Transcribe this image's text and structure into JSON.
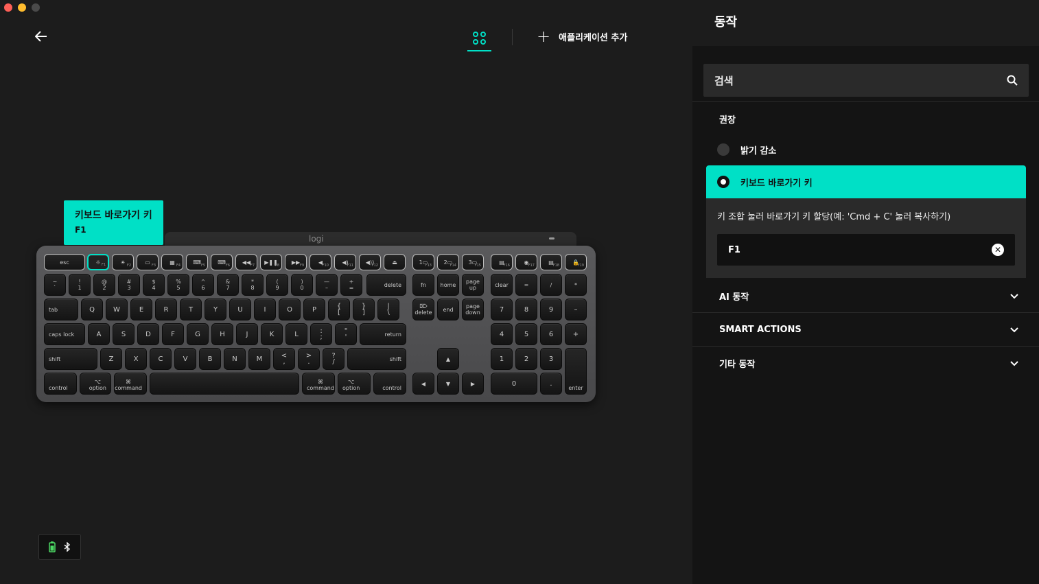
{
  "window": {
    "traffic_lights": [
      "close",
      "minimize",
      "maximize"
    ]
  },
  "topbar": {
    "back_icon": "arrow-left-icon",
    "apps_icon": "apps-grid-icon",
    "add_app_label": "애플리케이션 추가",
    "accent_color": "#00e0c6"
  },
  "keyboard": {
    "logo": "logi",
    "selected_key": "F1",
    "tooltip": {
      "title": "키보드 바로가기 키",
      "key": "F1"
    },
    "rows": {
      "fn": [
        {
          "main": "esc",
          "sub": "",
          "w": 1
        },
        {
          "main": "☼",
          "sub": "F1",
          "sel": true
        },
        {
          "main": "☀",
          "sub": "F2"
        },
        {
          "main": "▭",
          "sub": "F3"
        },
        {
          "main": "▦",
          "sub": "F4"
        },
        {
          "main": "⌨",
          "sub": "F5"
        },
        {
          "main": "⌨",
          "sub": "F6"
        },
        {
          "main": "◀◀",
          "sub": "F7"
        },
        {
          "main": "▶❚❚",
          "sub": "F8"
        },
        {
          "main": "▶▶",
          "sub": "F9"
        },
        {
          "main": "◀",
          "sub": "F10"
        },
        {
          "main": "◀)",
          "sub": "F11"
        },
        {
          "main": "◀))",
          "sub": "F12"
        },
        {
          "main": "⏏",
          "sub": ""
        },
        {
          "main": "1▭",
          "sub": "F13"
        },
        {
          "main": "2▭",
          "sub": "F14"
        },
        {
          "main": "3▭",
          "sub": "F15"
        },
        {
          "main": "▤",
          "sub": "F16"
        },
        {
          "main": "◉",
          "sub": "F17"
        },
        {
          "main": "▤",
          "sub": "F18"
        },
        {
          "main": "🔒",
          "sub": "F19"
        }
      ],
      "num": [
        [
          "~",
          "`"
        ],
        [
          "!",
          "1"
        ],
        [
          "@",
          "2"
        ],
        [
          "#",
          "3"
        ],
        [
          "$",
          "4"
        ],
        [
          "%",
          "5"
        ],
        [
          "^",
          "6"
        ],
        [
          "&",
          "7"
        ],
        [
          "*",
          "8"
        ],
        [
          "(",
          "9"
        ],
        [
          ")",
          "0"
        ],
        [
          "—",
          "–"
        ],
        [
          "+",
          "="
        ],
        [
          "",
          "delete"
        ],
        [
          "",
          "fn"
        ],
        [
          "",
          "home"
        ],
        [
          "page",
          "up"
        ],
        [
          "",
          "clear"
        ],
        [
          "",
          "="
        ],
        [
          "",
          "/"
        ],
        [
          "",
          "*"
        ]
      ],
      "qwerty": [
        "tab",
        "Q",
        "W",
        "E",
        "R",
        "T",
        "Y",
        "U",
        "I",
        "O",
        "P",
        "{ [",
        "} ]",
        "| \\",
        "⌦ delete",
        "end",
        "page down",
        "7",
        "8",
        "9",
        "–"
      ],
      "home": [
        "caps lock",
        "A",
        "S",
        "D",
        "F",
        "G",
        "H",
        "J",
        "K",
        "L",
        ": ;",
        "\" '",
        "return",
        "4",
        "5",
        "6",
        "+"
      ],
      "shift": [
        "shift",
        "Z",
        "X",
        "C",
        "V",
        "B",
        "N",
        "M",
        "< ,",
        "> .",
        "? /",
        "shift",
        "▲",
        "1",
        "2",
        "3",
        "enter"
      ],
      "bottom": [
        "control",
        "⌥ option",
        "⌘ command",
        "",
        "⌘ command",
        "⌥ option",
        "control",
        "◀",
        "▼",
        "▶",
        "0",
        "."
      ]
    }
  },
  "status": {
    "battery_icon": "battery-icon",
    "bluetooth_icon": "bluetooth-icon",
    "battery_color": "#4cd964"
  },
  "panel": {
    "title": "동작",
    "search_placeholder": "검색",
    "search_icon": "search-icon",
    "recommended_label": "권장",
    "options": [
      {
        "label": "밝기 감소",
        "selected": false
      },
      {
        "label": "키보드 바로가기 키",
        "selected": true
      }
    ],
    "detail": {
      "description": "키 조합 눌러 바로가기 키 할당(예: 'Cmd + C' 눌러 복사하기)",
      "value": "F1"
    },
    "accordions": [
      {
        "label": "AI 동작"
      },
      {
        "label": "SMART ACTIONS"
      },
      {
        "label": "기타 동작"
      }
    ]
  }
}
